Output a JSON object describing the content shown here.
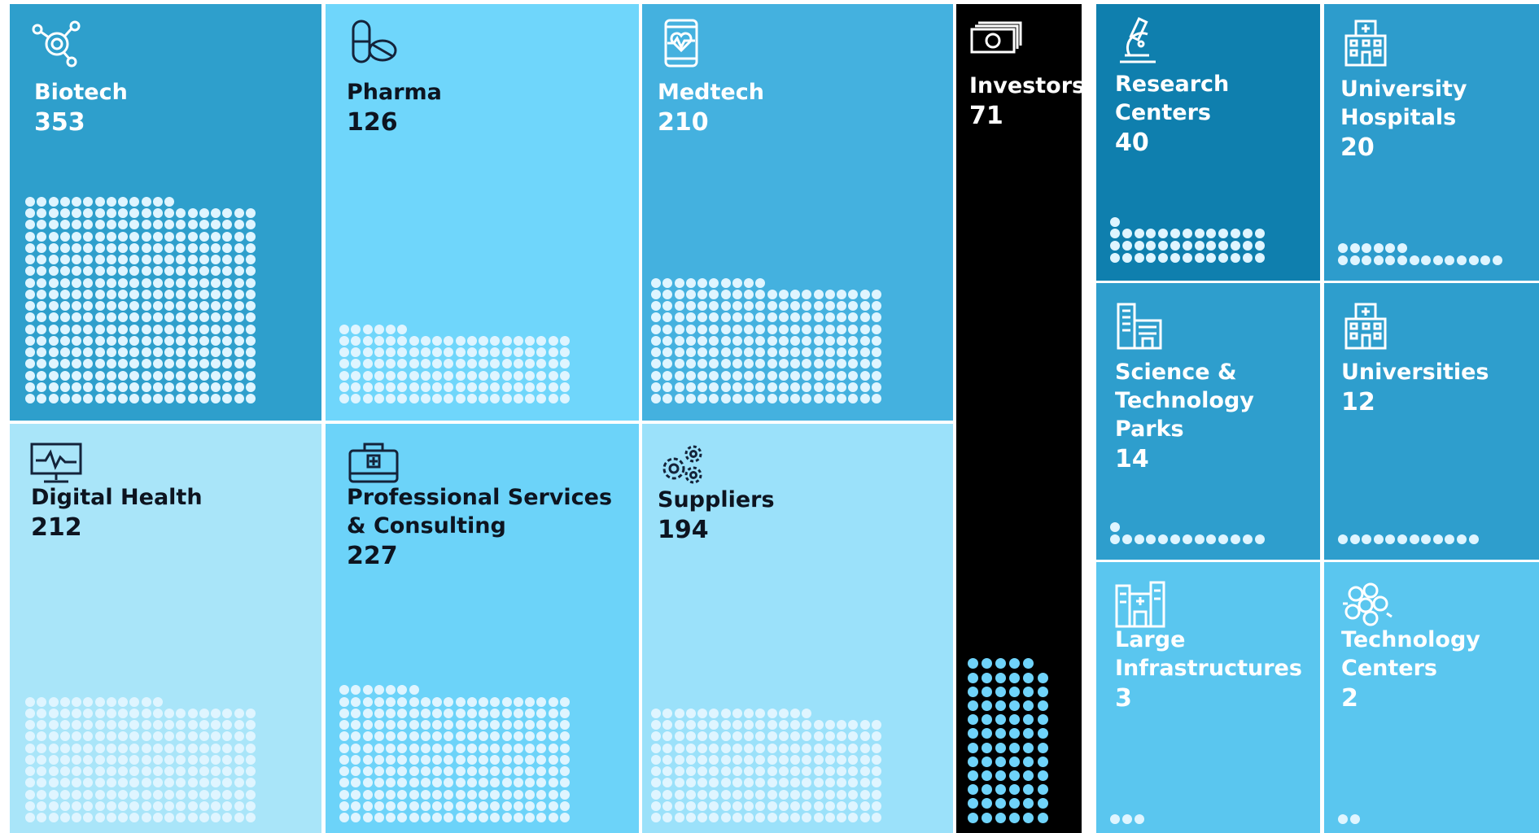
{
  "colors": {
    "biotech": "#2e9fcc",
    "pharma": "#6fd6fb",
    "medtech": "#44b1df",
    "digital_health": "#a9e5f9",
    "professional_services": "#6cd3f9",
    "suppliers": "#9be1fa",
    "investors": "#000000",
    "research_centers": "#0f7fae",
    "university_hospitals": "#2d9ccc",
    "science_parks": "#2e9ecd",
    "universities": "#2e9ecd",
    "large_infrastructures": "#5ac6ef",
    "technology_centers": "#5ac6ef",
    "dot_light": "#dff5ff",
    "dot_investors": "#6fd3fa",
    "gap": "#ffffff"
  },
  "chart_data": {
    "type": "waffle-treemap",
    "unit": "",
    "categories": [
      {
        "key": "biotech",
        "label": "Biotech",
        "value": 353,
        "icon": "molecule-icon"
      },
      {
        "key": "pharma",
        "label": "Pharma",
        "value": 126,
        "icon": "pills-icon"
      },
      {
        "key": "medtech",
        "label": "Medtech",
        "value": 210,
        "icon": "heart-phone-icon"
      },
      {
        "key": "investors",
        "label": "Investors",
        "value": 71,
        "icon": "money-icon"
      },
      {
        "key": "research_centers",
        "label": "Research Centers",
        "value": 40,
        "icon": "microscope-icon"
      },
      {
        "key": "university_hospitals",
        "label": "University Hospitals",
        "value": 20,
        "icon": "hospital-icon"
      },
      {
        "key": "digital_health",
        "label": "Digital Health",
        "value": 212,
        "icon": "monitor-pulse-icon"
      },
      {
        "key": "professional_services",
        "label": "Professional Services & Consulting",
        "value": 227,
        "icon": "briefcase-medical-icon"
      },
      {
        "key": "suppliers",
        "label": "Suppliers",
        "value": 194,
        "icon": "gears-icon"
      },
      {
        "key": "science_parks",
        "label": "Science & Technology Parks",
        "value": 14,
        "icon": "buildings-icon"
      },
      {
        "key": "universities",
        "label": "Universities",
        "value": 12,
        "icon": "university-building-icon"
      },
      {
        "key": "large_infrastructures",
        "label": "Large Infrastructures",
        "value": 3,
        "icon": "infrastructure-icon"
      },
      {
        "key": "technology_centers",
        "label": "Technology Centers",
        "value": 2,
        "icon": "network-icon"
      }
    ]
  }
}
